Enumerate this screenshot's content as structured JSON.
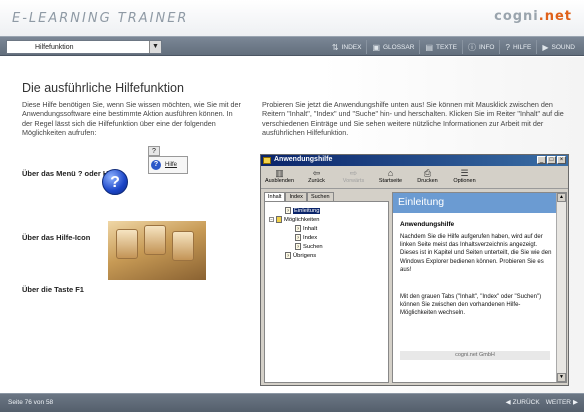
{
  "header": {
    "app_title": "E-LEARNING TRAINER",
    "brand": "cogni.net",
    "brand_colors": {
      "text": "#9aa4ad",
      "accent": "#e0611a"
    }
  },
  "toolbar": {
    "topic_select_value": "Hilfefunktion",
    "nav": [
      {
        "label": "INDEX",
        "icon": "index-icon"
      },
      {
        "label": "GLOSSAR",
        "icon": "glossary-icon"
      },
      {
        "label": "TEXTE",
        "icon": "texts-icon"
      },
      {
        "label": "INFO",
        "icon": "info-icon"
      },
      {
        "label": "HILFE",
        "icon": "help-icon"
      },
      {
        "label": "SOUND",
        "icon": "sound-icon"
      }
    ]
  },
  "content": {
    "title": "Die ausführliche Hilfefunktion",
    "intro_left": "Diese Hilfe benötigen Sie, wenn Sie wissen möchten, wie Sie mit der Anwendungssoftware eine bestimmte Aktion ausführen können. In der Regel lässt sich die Hilfefunktion über eine der folgenden Möglichkeiten aufrufen:",
    "intro_right": "Probieren Sie jetzt die Anwendungshilfe unten aus! Sie können mit Mausklick zwischen den Reitern \"Inhalt\", \"Index\" und \"Suche\" hin- und herschalten. Klicken Sie im Reiter \"Inhalt\" auf die verschiedenen Einträge und Sie sehen weitere nützliche Informationen zur Arbeit mit der ausführlichen Hilfefunktion.",
    "options": [
      {
        "label": "Über das Menü ? oder Hilfe"
      },
      {
        "label": "Über das Hilfe-Icon"
      },
      {
        "label": "Über die Taste F1"
      }
    ],
    "menu_mock": {
      "menu_q": "?",
      "item_label": "Hilfe"
    },
    "help_icon_glyph": "?"
  },
  "help_window": {
    "title": "Anwendungshilfe",
    "toolbar": [
      {
        "label": "Ausblenden",
        "icon": "hide-icon",
        "disabled": false
      },
      {
        "label": "Zurück",
        "icon": "back-icon",
        "disabled": false
      },
      {
        "label": "Vorwärts",
        "icon": "forward-icon",
        "disabled": true
      },
      {
        "label": "Startseite",
        "icon": "home-icon",
        "disabled": false
      },
      {
        "label": "Drucken",
        "icon": "print-icon",
        "disabled": false
      },
      {
        "label": "Optionen",
        "icon": "options-icon",
        "disabled": false
      }
    ],
    "tabs": [
      "Inhalt",
      "Index",
      "Suchen"
    ],
    "active_tab": "Inhalt",
    "tree": [
      {
        "label": "Einleitung",
        "level": 1,
        "selected": true,
        "type": "page"
      },
      {
        "label": "Möglichkeiten",
        "level": 0,
        "selected": false,
        "type": "book"
      },
      {
        "label": "Inhalt",
        "level": 2,
        "selected": false,
        "type": "page"
      },
      {
        "label": "Index",
        "level": 2,
        "selected": false,
        "type": "page"
      },
      {
        "label": "Suchen",
        "level": 2,
        "selected": false,
        "type": "page"
      },
      {
        "label": "Übrigens",
        "level": 1,
        "selected": false,
        "type": "page"
      }
    ],
    "topic": {
      "title": "Einleitung",
      "subheading": "Anwendungshilfe",
      "para1": "Nachdem Sie die Hilfe aufgerufen haben, wird auf der linken Seite meist das Inhaltsverzeichnis angezeigt. Dieses ist in Kapitel und Seiten unterteilt, die Sie wie den Windows Explorer bedienen können. Probieren Sie es aus!",
      "para2": "Mit den grauen Tabs (\"Inhalt\", \"Index\" oder \"Suchen\") können Sie zwischen den vorhandenen Hilfe-Möglichkeiten wechseln.",
      "footer": "cogni.net GmbH"
    }
  },
  "footer": {
    "page_counter": "Seite 76 von 58",
    "back_label": "ZURÜCK",
    "next_label": "WEITER"
  }
}
